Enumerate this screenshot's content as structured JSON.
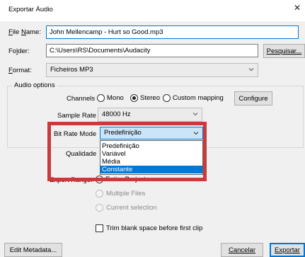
{
  "window": {
    "title": "Exportar Áudio",
    "close_glyph": "✕"
  },
  "form": {
    "file_name_label": "File Name:",
    "file_name_value": "John Mellencamp - Hurt so Good.mp3",
    "folder_label": "Folder:",
    "folder_value": "C:\\Users\\RS\\Documents\\Audacity",
    "browse_label": "Pesquisar...",
    "format_label": "Format:",
    "format_value": "Ficheiros MP3"
  },
  "audio_options": {
    "group_label": "Audio options",
    "channels_label": "Channels",
    "channels": [
      {
        "label": "Mono",
        "checked": false
      },
      {
        "label": "Stereo",
        "checked": true
      },
      {
        "label": "Custom mapping",
        "checked": false
      }
    ],
    "configure_label": "Configure",
    "sample_rate_label": "Sample Rate",
    "sample_rate_value": "48000 Hz",
    "bit_rate_mode_label": "Bit Rate Mode",
    "bit_rate_mode_value": "Predefinição",
    "bit_rate_mode_options": [
      "Predefinição",
      "Variável",
      "Média",
      "Constante"
    ],
    "bit_rate_mode_highlighted": "Constante",
    "quality_label": "Qualidade"
  },
  "export_range": {
    "label": "Export Range:",
    "options": [
      {
        "label": "Entire Project",
        "checked": true
      },
      {
        "label": "Multiple Files",
        "checked": false
      },
      {
        "label": "Current selection",
        "checked": false
      }
    ],
    "trim_label": "Trim blank space before first clip"
  },
  "footer": {
    "edit_metadata_label": "Edit Metadata...",
    "cancel_label": "Cancelar",
    "export_label": "Exportar"
  },
  "colors": {
    "highlight_border": "#c83b3b",
    "selection": "#0078d7"
  }
}
